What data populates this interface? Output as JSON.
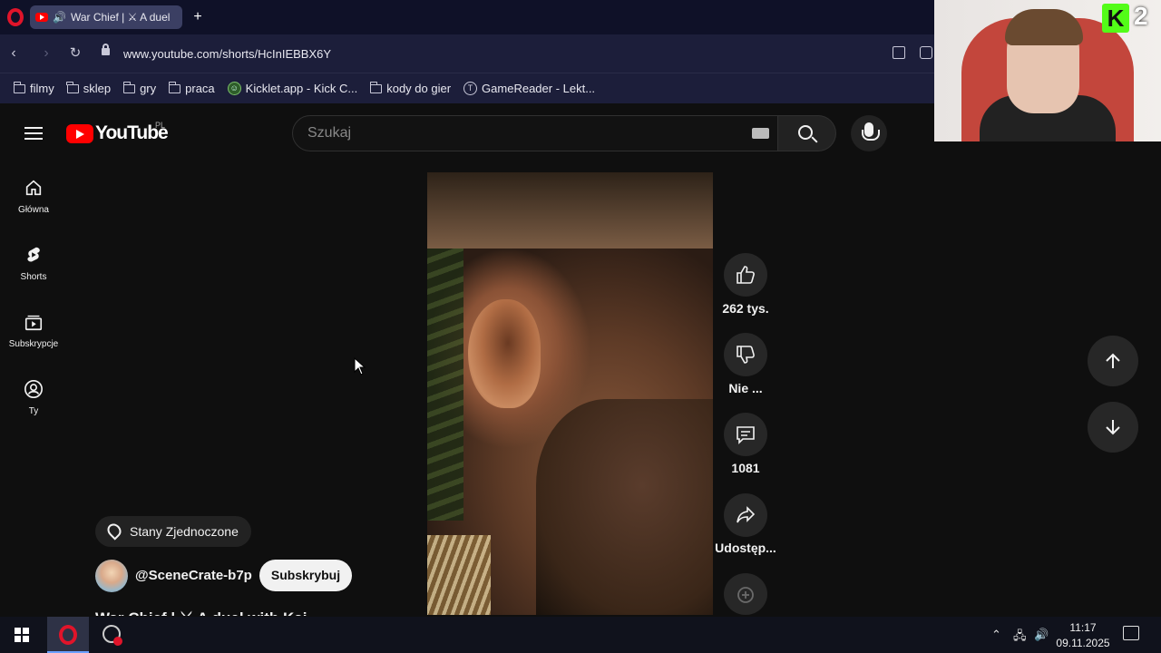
{
  "browser": {
    "tab_title": "War Chief | ⚔ A duel",
    "new_tab_icon": "plus-icon",
    "url": "www.youtube.com/shorts/HcInIEBBX6Y",
    "bookmarks": [
      {
        "label": "filmy",
        "icon": "folder-icon"
      },
      {
        "label": "sklep",
        "icon": "folder-icon"
      },
      {
        "label": "gry",
        "icon": "folder-icon"
      },
      {
        "label": "praca",
        "icon": "folder-icon"
      },
      {
        "label": "Kicklet.app - Kick C...",
        "icon": "kicklet-icon"
      },
      {
        "label": "kody do gier",
        "icon": "folder-icon"
      },
      {
        "label": "GameReader - Lekt...",
        "icon": "gamereader-icon"
      }
    ]
  },
  "youtube": {
    "logo_text": "YouTube",
    "country": "PL",
    "search_placeholder": "Szukaj",
    "sidebar": [
      {
        "label": "Główna",
        "icon": "home-icon"
      },
      {
        "label": "Shorts",
        "icon": "shorts-icon"
      },
      {
        "label": "Subskrypcje",
        "icon": "subscriptions-icon"
      },
      {
        "label": "Ty",
        "icon": "user-icon"
      }
    ],
    "actions": {
      "likes": "262 tys.",
      "dislike": "Nie ...",
      "comments": "1081",
      "share": "Udostęp..."
    },
    "location": "Stany Zjednoczone",
    "channel": "@SceneCrate-b7p",
    "subscribe": "Subskrybuj",
    "video_title": "War Chief | ⚔ A duel with Kai"
  },
  "overlay": {
    "kick_letter": "K",
    "kick_number": "2"
  },
  "taskbar": {
    "time": "11:17",
    "date": "09.11.2025"
  },
  "colors": {
    "yt_red": "#ff0000",
    "background": "#0f0f0f",
    "kick_green": "#53fc18"
  }
}
